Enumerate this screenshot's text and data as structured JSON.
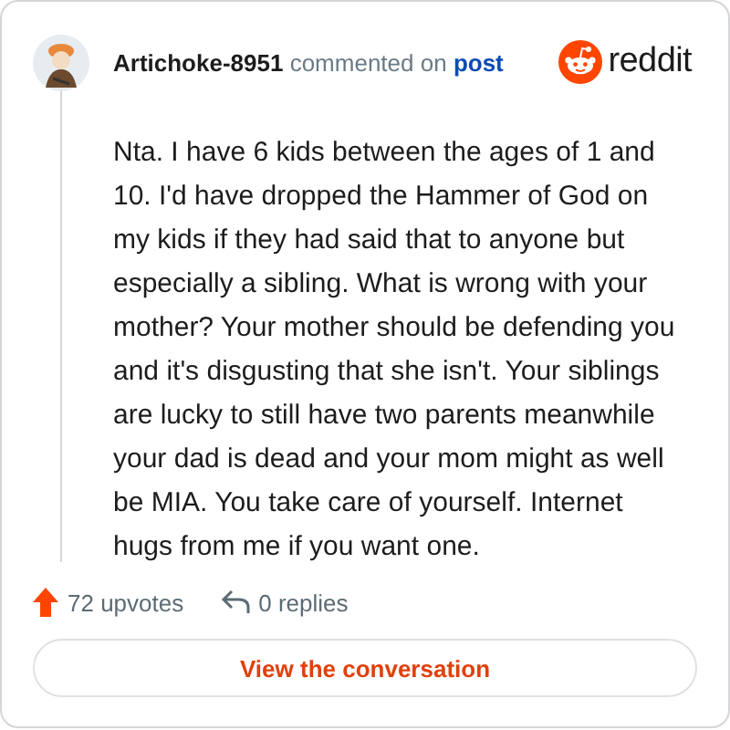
{
  "header": {
    "username": "Artichoke-8951",
    "action": "commented on",
    "link": "post",
    "brand": "reddit"
  },
  "comment": "Nta. I have 6 kids between the ages of 1 and 10. I'd have dropped the Hammer of God on my kids if they had said that to anyone but especially a sibling. What is wrong with your mother? Your mother should be defending you and it's disgusting that she isn't. Your siblings are lucky to still have two parents meanwhile your dad is dead and your mom might as well be MIA. You take care of yourself. Internet hugs from me if you want one.",
  "stats": [
    {
      "kind": "upvotes",
      "label": "72 upvotes"
    },
    {
      "kind": "replies",
      "label": "0 replies"
    }
  ],
  "button": "View the conversation"
}
